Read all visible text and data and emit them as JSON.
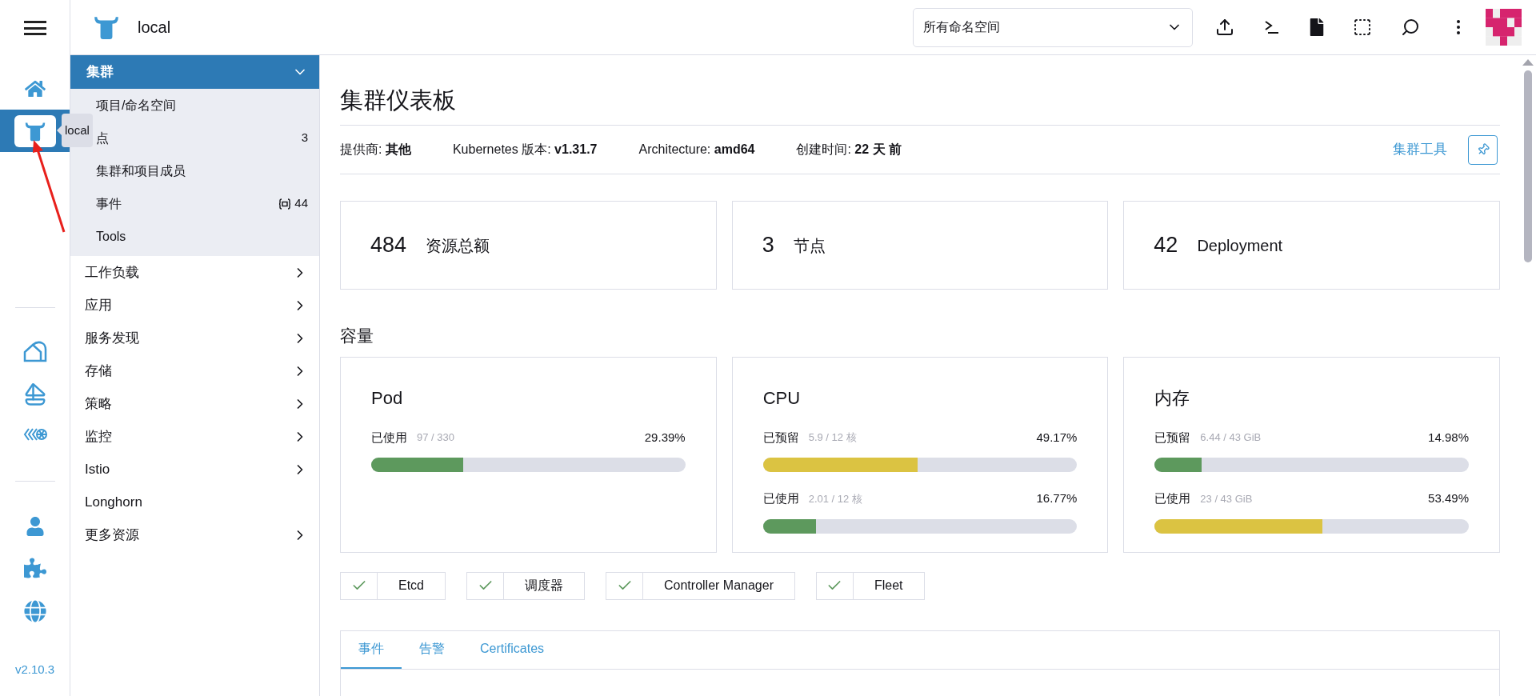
{
  "header": {
    "cluster_name": "local",
    "namespace_select": {
      "value": "所有命名空间"
    }
  },
  "rail": {
    "items": [
      {
        "kind": "home",
        "selected": false
      },
      {
        "kind": "cluster",
        "selected": true,
        "tooltip": "local"
      }
    ],
    "version": "v2.10.3"
  },
  "nav": {
    "group": {
      "label": "集群",
      "expanded": true,
      "children": [
        {
          "label": "项目/命名空间"
        },
        {
          "label": "点",
          "count": "3"
        },
        {
          "label": "集群和项目成员"
        },
        {
          "label": "事件",
          "count": "44",
          "count_icon": true
        },
        {
          "label": "Tools"
        }
      ]
    },
    "items": [
      {
        "label": "工作负载",
        "has_children": true
      },
      {
        "label": "应用",
        "has_children": true
      },
      {
        "label": "服务发现",
        "has_children": true
      },
      {
        "label": "存储",
        "has_children": true
      },
      {
        "label": "策略",
        "has_children": true
      },
      {
        "label": "监控",
        "has_children": true
      },
      {
        "label": "Istio",
        "has_children": true
      },
      {
        "label": "Longhorn",
        "has_children": false
      },
      {
        "label": "更多资源",
        "has_children": true
      }
    ]
  },
  "main": {
    "title": "集群仪表板",
    "facts": [
      {
        "label": "提供商:",
        "value": "其他"
      },
      {
        "label": "Kubernetes 版本:",
        "value": "v1.31.7"
      },
      {
        "label": "Architecture:",
        "value": "amd64"
      },
      {
        "label": "创建时间:",
        "value": "22 天 前"
      }
    ],
    "tools_link": "集群工具",
    "counts": [
      {
        "value": "484",
        "label": "资源总额"
      },
      {
        "value": "3",
        "label": "节点"
      },
      {
        "value": "42",
        "label": "Deployment"
      }
    ],
    "capacity_title": "容量",
    "capacity": [
      {
        "title": "Pod",
        "meters": [
          {
            "label": "已使用",
            "detail": "97 / 330",
            "percent": "29.39%",
            "level": 0.2939,
            "color": "#5d995d"
          }
        ]
      },
      {
        "title": "CPU",
        "meters": [
          {
            "label": "已预留",
            "detail": "5.9 / 12 核",
            "percent": "49.17%",
            "level": 0.4917,
            "color": "#dbc342"
          },
          {
            "label": "已使用",
            "detail": "2.01 / 12 核",
            "percent": "16.77%",
            "level": 0.1677,
            "color": "#5d995d"
          }
        ]
      },
      {
        "title": "内存",
        "meters": [
          {
            "label": "已预留",
            "detail": "6.44 / 43 GiB",
            "percent": "14.98%",
            "level": 0.1498,
            "color": "#5d995d"
          },
          {
            "label": "已使用",
            "detail": "23 / 43 GiB",
            "percent": "53.49%",
            "level": 0.5349,
            "color": "#dbc342"
          }
        ]
      }
    ],
    "components": [
      {
        "label": "Etcd",
        "ok": true
      },
      {
        "label": "调度器",
        "ok": true
      },
      {
        "label": "Controller Manager",
        "ok": true
      },
      {
        "label": "Fleet",
        "ok": true
      }
    ],
    "tabs": [
      {
        "label": "事件",
        "selected": true
      },
      {
        "label": "告警",
        "selected": false
      },
      {
        "label": "Certificates",
        "selected": false
      }
    ]
  }
}
